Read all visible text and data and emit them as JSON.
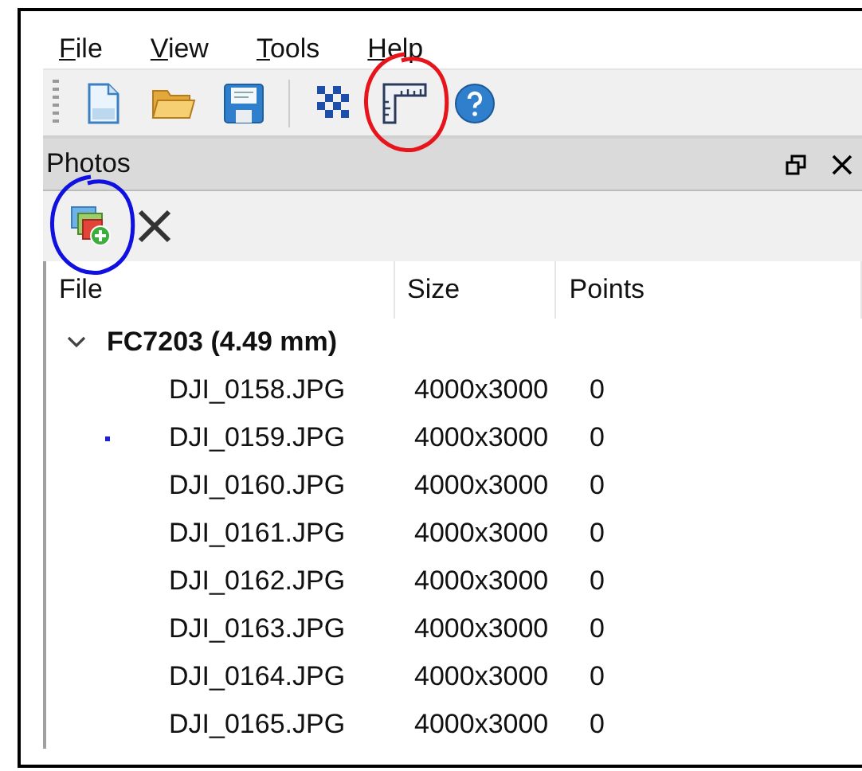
{
  "menu": [
    "File",
    "View",
    "Tools",
    "Help"
  ],
  "toolbar": [
    {
      "kind": "new"
    },
    {
      "kind": "open"
    },
    {
      "kind": "save"
    },
    {
      "kind": "separator"
    },
    {
      "kind": "checker"
    },
    {
      "kind": "ruler",
      "annotation": {
        "color": "#e8141c"
      }
    },
    {
      "kind": "help"
    }
  ],
  "panel": {
    "title": "Photos",
    "toolbar": [
      {
        "kind": "add",
        "annotation": {
          "color": "#1010e0"
        }
      },
      {
        "kind": "remove"
      }
    ],
    "columns": [
      "File",
      "Size",
      "Points"
    ],
    "groups": [
      {
        "label": "FC7203 (4.49 mm)",
        "expanded": true,
        "children": [
          {
            "file": "DJI_0158.JPG",
            "size": "4000x3000",
            "points": "0",
            "marked": false
          },
          {
            "file": "DJI_0159.JPG",
            "size": "4000x3000",
            "points": "0",
            "marked": true
          },
          {
            "file": "DJI_0160.JPG",
            "size": "4000x3000",
            "points": "0",
            "marked": false
          },
          {
            "file": "DJI_0161.JPG",
            "size": "4000x3000",
            "points": "0",
            "marked": false
          },
          {
            "file": "DJI_0162.JPG",
            "size": "4000x3000",
            "points": "0",
            "marked": false
          },
          {
            "file": "DJI_0163.JPG",
            "size": "4000x3000",
            "points": "0",
            "marked": false
          },
          {
            "file": "DJI_0164.JPG",
            "size": "4000x3000",
            "points": "0",
            "marked": false
          },
          {
            "file": "DJI_0165.JPG",
            "size": "4000x3000",
            "points": "0",
            "marked": false
          }
        ]
      }
    ]
  }
}
